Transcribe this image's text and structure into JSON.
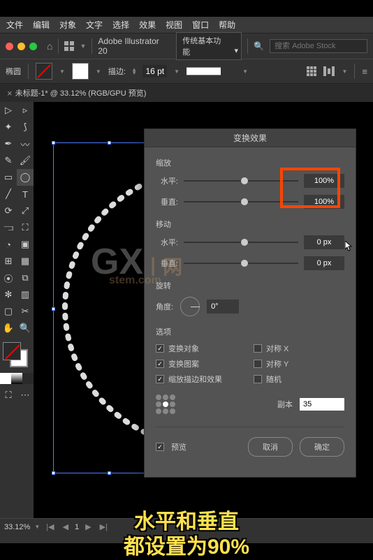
{
  "menubar": [
    "文件",
    "编辑",
    "对象",
    "文字",
    "选择",
    "效果",
    "视图",
    "窗口",
    "帮助"
  ],
  "topbar": {
    "app_name": "Adobe Illustrator 20",
    "workspace_dropdown": "传统基本功能",
    "search_placeholder": "搜索 Adobe Stock"
  },
  "controlbar": {
    "shape_label": "椭圆",
    "stroke_label": "描边:",
    "stroke_value": "16 pt"
  },
  "doctab": {
    "title": "未标题-1* @ 33.12% (RGB/GPU 预览)"
  },
  "dialog": {
    "title": "变换效果",
    "scale_label": "缩放",
    "horizontal_label": "水平:",
    "vertical_label": "垂直:",
    "scale_h_value": "100%",
    "scale_v_value": "100%",
    "move_label": "移动",
    "move_h_value": "0 px",
    "move_v_value": "0 px",
    "rotate_label": "旋转",
    "angle_label": "角度:",
    "angle_value": "0°",
    "options_label": "选项",
    "opt_transform_obj": "变换对象",
    "opt_transform_pat": "变换图案",
    "opt_scale_stroke": "缩放描边和效果",
    "opt_reflect_x": "对称 X",
    "opt_reflect_y": "对称 Y",
    "opt_random": "随机",
    "copies_label": "副本",
    "copies_value": "35",
    "preview_label": "预览",
    "cancel_label": "取消",
    "ok_label": "确定"
  },
  "statusbar": {
    "zoom": "33.12%",
    "page": "1"
  },
  "watermark": {
    "main": "GX",
    "sub": "丨网",
    "domain": "stem.com"
  },
  "caption": {
    "line1": "水平和垂直",
    "line2": "都设置为90%"
  }
}
